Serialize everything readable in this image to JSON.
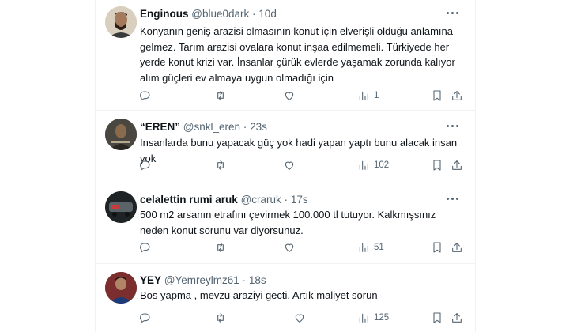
{
  "tweets": [
    {
      "name": "Enginous",
      "handle": "@blue0dark",
      "sep": "·",
      "time": "10d",
      "text": "Konyanın geniş arazisi olmasının konut için elverişli olduğu anlamına gelmez. Tarım arazisi ovalara konut inşaa edilmemeli. Türkiyede her yerde konut krizi var. İnsanlar çürük evlerde yaşamak zorunda kalıyor alım güçleri ev almaya uygun olmadığı için",
      "views": "1"
    },
    {
      "name": "“EREN”",
      "handle": "@snkl_eren",
      "sep": "·",
      "time": "23s",
      "text": "İnsanlarda bunu yapacak güç yok hadi yapan yaptı bunu alacak insan yok",
      "views": "102"
    },
    {
      "name": "celalettin rumi aruk",
      "handle": "@craruk",
      "sep": "·",
      "time": "17s",
      "text": "500 m2 arsanın etrafını çevirmek 100.000 tl tutuyor. Kalkmışsınız neden konut sorunu var diyorsunuz.",
      "views": "51"
    },
    {
      "name": "YEY",
      "handle": "@Yemreylmz61",
      "sep": "·",
      "time": "18s",
      "text": "Bos yapma , mevzu araziyi gecti. Artık maliyet sorun",
      "views": "125"
    }
  ],
  "icons": {
    "reply": "reply-icon",
    "retweet": "retweet-icon",
    "like": "heart-icon",
    "views": "views-icon",
    "bookmark": "bookmark-icon",
    "share": "share-icon",
    "more": "more-icon"
  },
  "colors": {
    "text": "#0f1419",
    "secondary": "#536471",
    "border": "#eff3f4"
  }
}
